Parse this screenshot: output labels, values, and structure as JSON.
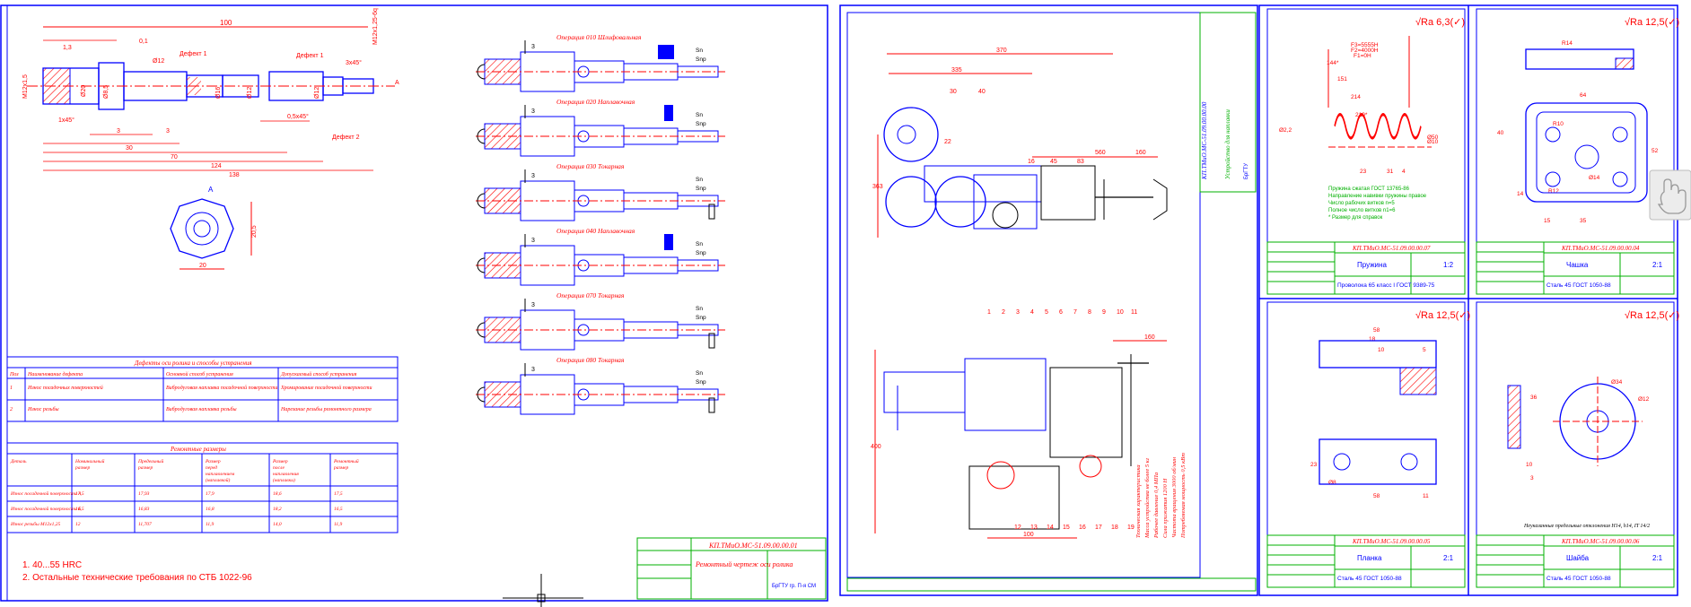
{
  "colors": {
    "red": "#ff0000",
    "blue": "#0000ff",
    "green": "#00b000",
    "yellow": "#e8e800",
    "black": "#000000",
    "white": "#ffffff"
  },
  "sheet1": {
    "shaft": {
      "overall": "100",
      "dims_top": [
        "1,3",
        "0,1",
        "Дефект 1",
        "Дефект 1",
        "3х45°",
        "М12х1,25-6q"
      ],
      "dims_side": [
        "М12х1,5",
        "1х45°",
        "3",
        "3",
        "30",
        "70",
        "124",
        "138",
        "0,5х45°",
        "Дефект 2",
        "А"
      ],
      "dia": [
        "Ø20",
        "Ø8,5",
        "Ø12",
        "Ø16",
        "Ø12",
        "Ø12"
      ]
    },
    "section": {
      "label": "А",
      "width": "20",
      "height": "20,5"
    },
    "ops": [
      {
        "title": "Операция 010 Шлифовальная",
        "num": "3",
        "a": "Sn",
        "b": "Snp"
      },
      {
        "title": "Операция 020 Наплавочная",
        "num": "3",
        "a": "Sn",
        "b": "Snp"
      },
      {
        "title": "Операция 030 Токарная",
        "num": "3",
        "a": "Sn",
        "b": "Snp"
      },
      {
        "title": "Операция 040 Наплавочная",
        "num": "3",
        "a": "Sn",
        "b": "Snp"
      },
      {
        "title": "Операция 070 Токарная",
        "num": "3",
        "a": "Sn",
        "b": "Snp"
      },
      {
        "title": "Операция 080 Токарная",
        "num": "3",
        "a": "Sn",
        "b": "Snp"
      }
    ],
    "defects_table": {
      "title": "Дефекты оси ролика и способы устранения",
      "headers": [
        "Поз",
        "Наименование дефекта",
        "Основной способ устранения",
        "Допускаемый способ устранения"
      ],
      "rows": [
        [
          "1",
          "Износ посадочных поверхностей",
          "Вибродуговая наплавка посадочной поверхности",
          "Хромирование посадочной поверхности"
        ],
        [
          "2",
          "Износ резьбы",
          "Вибродуговая наплавка резьбы",
          "Нарезание резьбы ремонтного размера"
        ]
      ]
    },
    "repair_table": {
      "title": "Ремонтные размеры",
      "headers": [
        "Деталь",
        "Номинальный размер",
        "Предельный размер",
        "Размер перед наплавлением (наплавкой)",
        "Размер после наплавления (наплавки)",
        "Ремонтный размер"
      ],
      "rows": [
        [
          "Износ посадочной поверхности А",
          "17,5",
          "17,93",
          "17,9",
          "18,6",
          "17,5"
        ],
        [
          "Износ посадочной поверхности Б",
          "16,5",
          "16,83",
          "16,8",
          "18,2",
          "16,5"
        ],
        [
          "Износ резьбы М12х1,25",
          "12",
          "11,707",
          "11,9",
          "14,0",
          "11,9"
        ]
      ]
    },
    "notes": [
      "1. 40...55 HRC",
      "2. Остальные технические требования по СТБ 1022-96"
    ],
    "stamp": {
      "code": "КП.ТМиО.МС-51.09.00.00.01",
      "name": "Ремонтный чертеж оси ролика",
      "org": "БрГТУ гр. П-я СМ"
    }
  },
  "sheet2": {
    "dims": [
      "370",
      "335",
      "22",
      "16",
      "45",
      "83",
      "160",
      "363",
      "30",
      "40",
      "160",
      "400",
      "100",
      "560"
    ],
    "positions": [
      "1",
      "2",
      "3",
      "4",
      "5",
      "6",
      "7",
      "8",
      "9",
      "10",
      "11",
      "12",
      "13",
      "14",
      "15",
      "16",
      "17",
      "18",
      "19"
    ],
    "specs": [
      "Техническая характеристика",
      "Масса устройства не более 5 кг",
      "Рабочее давление 0,4 МПа",
      "Сила прижатия 1200 Н",
      "Частота вращения 3000 об/мин",
      "Потребляемая мощность 0,5 кВт"
    ],
    "stamp": {
      "code": "КП.ТМиО.МС-51.09.00.00.00",
      "name": "Устройство для наплавки",
      "org": "БрГТУ"
    }
  },
  "sheet3": {
    "ra": "Ra 6,3",
    "dims": [
      "F3=5555Н",
      "F2=4000Н",
      "F1=0Н",
      "144*",
      "151",
      "214",
      "210*",
      "Ø10",
      "Ø50",
      "Ø2,2",
      "23",
      "31",
      "4"
    ],
    "notes": [
      "Пружина сжатая ГОСТ 13765-86",
      "Направление навивки пружины правое",
      "Число рабочих витков n=5",
      "Полное число витков n1=6",
      "* Размер для справок"
    ],
    "name": "Пружина",
    "scale": "1:2",
    "mat": "Проволока 65 класс I ГОСТ 9389-75",
    "stamp": "КП.ТМиО.МС-51.09.00.00.07"
  },
  "sheet4": {
    "ra": "Ra 12,5",
    "dims": [
      "R14",
      "64",
      "52",
      "R10",
      "R12",
      "Ø14",
      "15",
      "35",
      "40",
      "14"
    ],
    "name": "Чашка",
    "scale": "2:1",
    "mat": "Сталь 45 ГОСТ 1050-88",
    "stamp": "КП.ТМиО.МС-51.09.00.00.04"
  },
  "sheet5": {
    "ra": "Ra 12,5",
    "dims": [
      "58",
      "18",
      "10",
      "5",
      "23",
      "Ø8",
      "58",
      "11"
    ],
    "name": "Планка",
    "scale": "2:1",
    "mat": "Сталь 45 ГОСТ 1050-88",
    "stamp": "КП.ТМиО.МС-51.09.00.00.05"
  },
  "sheet6": {
    "ra": "Ra 12,5",
    "dims": [
      "Ø12",
      "36",
      "10",
      "3",
      "Ø34"
    ],
    "note": "Неуказанные предельные отклонения Н14, h14, IT 14/2",
    "name": "Шайба",
    "scale": "2:1",
    "mat": "Сталь 45 ГОСТ 1050-88",
    "stamp": "КП.ТМиО.МС-51.09.00.00.06"
  }
}
